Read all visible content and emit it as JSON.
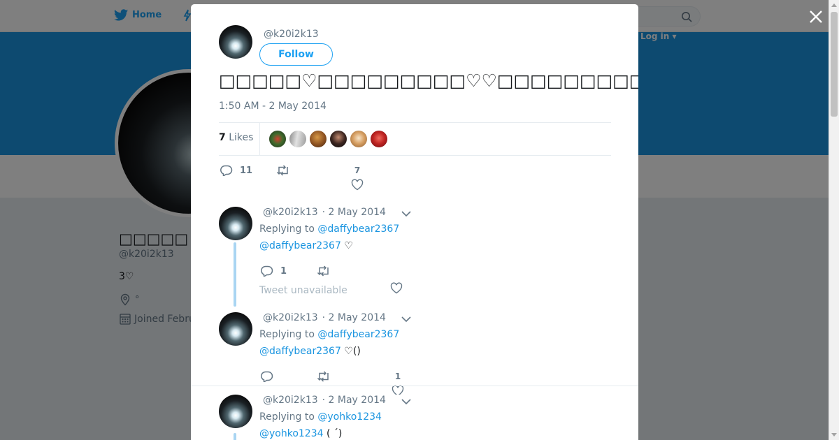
{
  "nav": {
    "home_label": "Home",
    "login_label": "Log in ▾"
  },
  "profile": {
    "name": "□□□□□",
    "handle": "@k20i2k13",
    "bio": "3♡",
    "location": "°",
    "joined": "Joined Febru"
  },
  "tweet": {
    "handle": "@k20i2k13",
    "follow_label": "Follow",
    "text": "□□□□□♡□□□□□□□□□♡♡□□□□□□□□□(≧∇≦)□□□□□□□□□□□□□♬*",
    "timestamp": "1:50 AM - 2 May 2014",
    "likes_count": "7",
    "likes_label": "Likes",
    "reply_count": "11",
    "like_count": "7"
  },
  "replies": [
    {
      "handle": "@k20i2k13",
      "date": "· 2 May 2014",
      "replying_prefix": "Replying to",
      "replying_to": "@daffybear2367",
      "mention": "@daffybear2367",
      "text": " ♡",
      "reply_count": "1",
      "like_count": "",
      "note": "Tweet unavailable"
    },
    {
      "handle": "@k20i2k13",
      "date": "· 2 May 2014",
      "replying_prefix": "Replying to",
      "replying_to": "@daffybear2367",
      "mention": "@daffybear2367",
      "text": " ♡()",
      "reply_count": "",
      "like_count": "1"
    },
    {
      "handle": "@k20i2k13",
      "date": "· 2 May 2014",
      "replying_prefix": "Replying to",
      "replying_to": "@yohko1234",
      "mention": "@yohko1234",
      "text": " ( ´)"
    }
  ],
  "colors": {
    "accent": "#1da1f2",
    "banner": "#1b95e0",
    "muted": "#657786"
  },
  "icons": [
    "twitter-bird-icon",
    "search-icon",
    "close-icon",
    "reply-icon",
    "retweet-icon",
    "heart-icon",
    "chevron-down-icon",
    "location-icon",
    "calendar-icon"
  ]
}
